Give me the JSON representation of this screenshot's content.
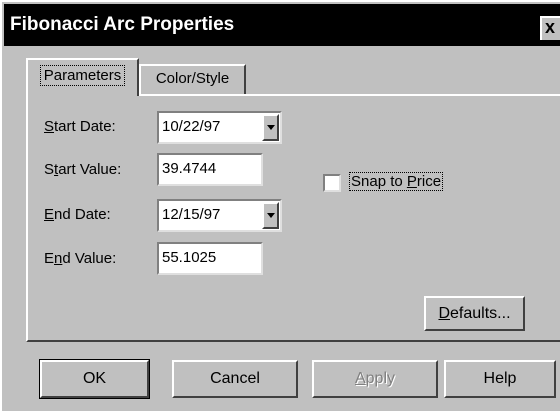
{
  "window": {
    "title": "Fibonacci Arc Properties",
    "close_glyph": "x"
  },
  "tabs": [
    {
      "label": "Parameters",
      "selected": true
    },
    {
      "label": "Color/Style",
      "selected": false
    }
  ],
  "parameters": {
    "start_date": {
      "label_prefix": "",
      "label_mnemonic": "S",
      "label_rest": "tart Date:",
      "value": "10/22/97"
    },
    "start_value": {
      "label_prefix": "S",
      "label_mnemonic": "t",
      "label_rest": "art Value:",
      "value": "39.4744"
    },
    "end_date": {
      "label_prefix": "",
      "label_mnemonic": "E",
      "label_rest": "nd Date:",
      "value": "12/15/97"
    },
    "end_value": {
      "label_prefix": "E",
      "label_mnemonic": "n",
      "label_rest": "d Value:",
      "value": "55.1025"
    },
    "snap_to_price": {
      "label_before": "Snap to ",
      "label_mnemonic": "P",
      "label_after": "rice",
      "checked": false
    },
    "defaults_button": {
      "mnemonic": "D",
      "rest": "efaults..."
    }
  },
  "buttons": {
    "ok": "OK",
    "cancel": "Cancel",
    "apply": {
      "mnemonic": "A",
      "rest": "pply",
      "enabled": false
    },
    "help": "Help"
  },
  "colors": {
    "face": "#c0c0c0",
    "titlebar": "#000000",
    "disabled_text": "#808080"
  }
}
